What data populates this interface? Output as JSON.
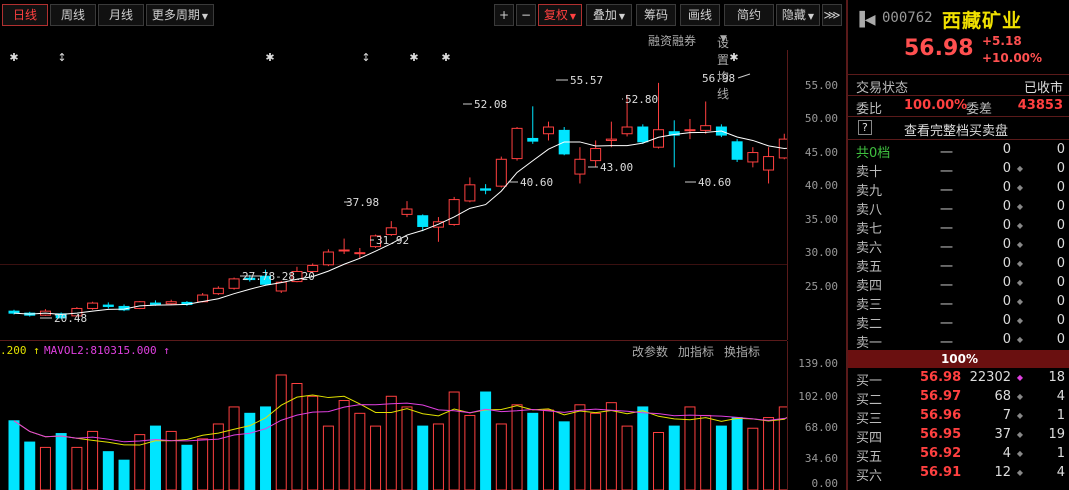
{
  "toolbar": {
    "tabs": [
      "日线",
      "周线",
      "月线",
      "更多周期"
    ],
    "right_buttons": [
      "+",
      "−",
      "复权",
      "叠加",
      "筹码",
      "画线",
      "简约",
      "隐藏"
    ],
    "more_arrow": "⋙"
  },
  "subbar": {
    "margin": "融资融券",
    "ma_settings": "设置均线"
  },
  "price_axis": [
    "55.00",
    "50.00",
    "45.00",
    "40.00",
    "35.00",
    "30.00",
    "25.00"
  ],
  "annotations": {
    "low1": "20.48",
    "range": "27.78-28.20",
    "p3798": "37.98",
    "p3192": "31.92",
    "p5208": "52.08",
    "p5557": "55.57",
    "p5280": "52.80",
    "p4300": "43.00",
    "p4060a": "40.60",
    "p4060b": "40.60",
    "last": "56.98"
  },
  "volume": {
    "ma1": ".200",
    "ma2": "MAVOL2:810315.000",
    "links": [
      "改参数",
      "加指标",
      "换指标"
    ],
    "axis": [
      "139.00",
      "102.00",
      "68.00",
      "34.60",
      "0.00"
    ]
  },
  "quote": {
    "code": "000762",
    "name": "西藏矿业",
    "price": "56.98",
    "change": "+5.18",
    "change_pct": "+10.00%",
    "status_label": "交易状态",
    "status_value": "已收市",
    "weibi_label": "委比",
    "weibi_value": "100.00%",
    "weicha_label": "委差",
    "weicha_value": "43853",
    "full_book": "查看完整档买卖盘",
    "help": "?",
    "total_label": "共0档",
    "asks": [
      {
        "label": "卖十",
        "price": "一",
        "vol": "0",
        "cnt": "0"
      },
      {
        "label": "卖九",
        "price": "一",
        "vol": "0",
        "cnt": "0"
      },
      {
        "label": "卖八",
        "price": "一",
        "vol": "0",
        "cnt": "0"
      },
      {
        "label": "卖七",
        "price": "一",
        "vol": "0",
        "cnt": "0"
      },
      {
        "label": "卖六",
        "price": "一",
        "vol": "0",
        "cnt": "0"
      },
      {
        "label": "卖五",
        "price": "一",
        "vol": "0",
        "cnt": "0"
      },
      {
        "label": "卖四",
        "price": "一",
        "vol": "0",
        "cnt": "0"
      },
      {
        "label": "卖三",
        "price": "一",
        "vol": "0",
        "cnt": "0"
      },
      {
        "label": "卖二",
        "price": "一",
        "vol": "0",
        "cnt": "0"
      },
      {
        "label": "卖一",
        "price": "一",
        "vol": "0",
        "cnt": "0"
      }
    ],
    "total_row": {
      "price": "一",
      "vol": "0",
      "cnt": "0"
    },
    "band": "100%",
    "bids": [
      {
        "label": "买一",
        "price": "56.98",
        "vol": "22302",
        "cnt": "18"
      },
      {
        "label": "买二",
        "price": "56.97",
        "vol": "68",
        "cnt": "4"
      },
      {
        "label": "买三",
        "price": "56.96",
        "vol": "7",
        "cnt": "1"
      },
      {
        "label": "买四",
        "price": "56.95",
        "vol": "37",
        "cnt": "19"
      },
      {
        "label": "买五",
        "price": "56.92",
        "vol": "4",
        "cnt": "1"
      },
      {
        "label": "买六",
        "price": "56.91",
        "vol": "12",
        "cnt": "4"
      }
    ]
  },
  "colors": {
    "up": "#ff4040",
    "down": "#00e5ff",
    "ma": "#ffffff",
    "vol_ma1": "#e0e000",
    "vol_ma2": "#e040e0",
    "bg": "#000000"
  }
}
